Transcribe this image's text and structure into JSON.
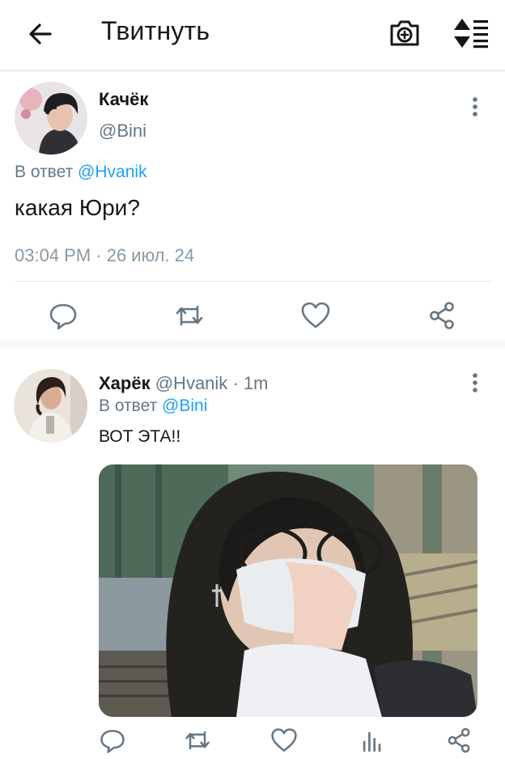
{
  "header": {
    "title": "Твитнуть",
    "back_icon": "arrow-left-icon",
    "camera_icon": "camera-plus-icon",
    "sort_icon": "sort-list-icon"
  },
  "tweet1": {
    "name": "Качёк",
    "handle": "@Bini",
    "reply_prefix": "В ответ",
    "reply_to": "@Hvanik",
    "text": "какая Юри?",
    "timestamp": "03:04 PM · 26 июл. 24",
    "actions": [
      "reply-icon",
      "retweet-icon",
      "like-icon",
      "share-icon"
    ]
  },
  "tweet2": {
    "name": "Харёк",
    "handle": "@Hvanik",
    "separator": "·",
    "age": "1m",
    "reply_prefix": "В ответ",
    "reply_to": "@Bini",
    "text": "ВОТ ЭТА!!",
    "actions": [
      "reply-icon",
      "retweet-icon",
      "like-icon",
      "stats-icon",
      "share-icon"
    ]
  },
  "colors": {
    "accent": "#1da1f2",
    "text": "#14171a",
    "muted": "#657786",
    "divider": "#e6ecf0"
  }
}
